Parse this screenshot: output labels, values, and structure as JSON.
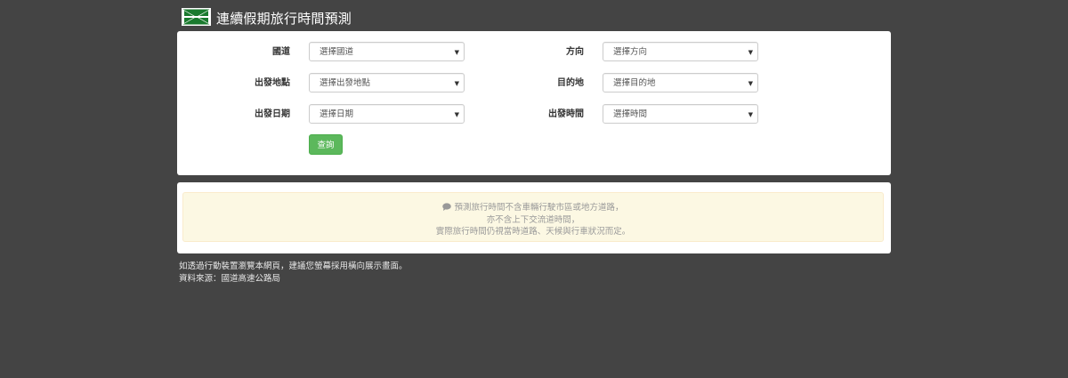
{
  "header": {
    "title": "連續假期旅行時間預測",
    "logo_icon": "highway-logo-icon"
  },
  "form": {
    "rows": [
      {
        "left_label": "國道",
        "left_value": "選擇國道",
        "right_label": "方向",
        "right_value": "選擇方向"
      },
      {
        "left_label": "出發地點",
        "left_value": "選擇出發地點",
        "right_label": "目的地",
        "right_value": "選擇目的地"
      },
      {
        "left_label": "出發日期",
        "left_value": "選擇日期",
        "right_label": "出發時間",
        "right_value": "選擇時間"
      }
    ],
    "dropdown_arrow": "▼",
    "submit_label": "查詢"
  },
  "notice": {
    "icon": "comment-icon",
    "lines": [
      "預測旅行時間不含車輛行駛市區或地方道路，",
      "亦不含上下交流道時間，",
      "實際旅行時間仍視當時道路、天候與行車狀況而定。"
    ]
  },
  "footer": {
    "line1": "如透過行動裝置瀏覽本網頁，建議您螢幕採用橫向展示畫面。",
    "line2": "資料來源：國道高速公路局"
  },
  "colors": {
    "background": "#444444",
    "panel": "#ffffff",
    "submit_button": "#5cb85c",
    "alert_bg": "#fcf8e3",
    "alert_border": "#faebcc"
  }
}
